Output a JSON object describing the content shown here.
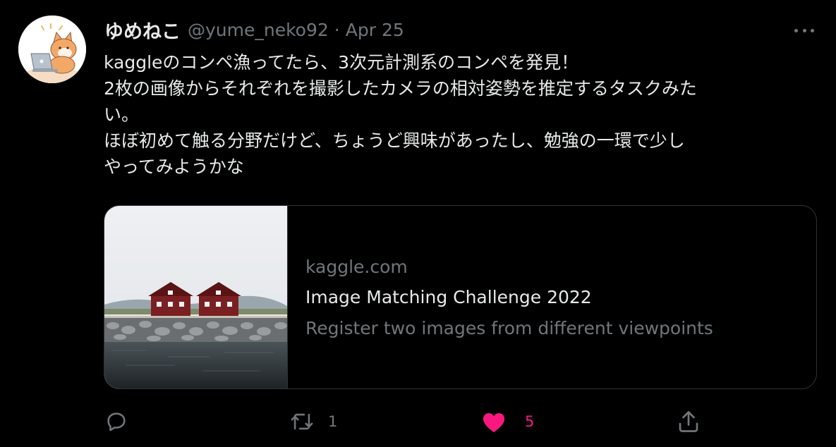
{
  "tweet": {
    "display_name": "ゆめねこ",
    "handle": "@yume_neko92",
    "separator": "·",
    "date": "Apr 25",
    "text_lines": [
      "kaggleのコンペ漁ってたら、3次元計測系のコンペを発見！",
      "2枚の画像からそれぞれを撮影したカメラの相対姿勢を推定するタスクみた",
      "い。",
      "ほぼ初めて触る分野だけど、ちょうど興味があったし、勉強の一環で少し",
      "やってみようかな"
    ]
  },
  "card": {
    "domain": "kaggle.com",
    "title": "Image Matching Challenge 2022",
    "description": "Register two images from different viewpoints"
  },
  "actions": {
    "reply": {
      "icon": "reply-icon"
    },
    "retweet": {
      "icon": "retweet-icon",
      "count": "1"
    },
    "like": {
      "icon": "heart-icon",
      "count": "5",
      "liked": true
    },
    "share": {
      "icon": "share-icon"
    }
  },
  "colors": {
    "background": "#000000",
    "text": "#e7e9ea",
    "secondary_text": "#71767b",
    "border": "#2f3336",
    "like": "#f91880"
  }
}
